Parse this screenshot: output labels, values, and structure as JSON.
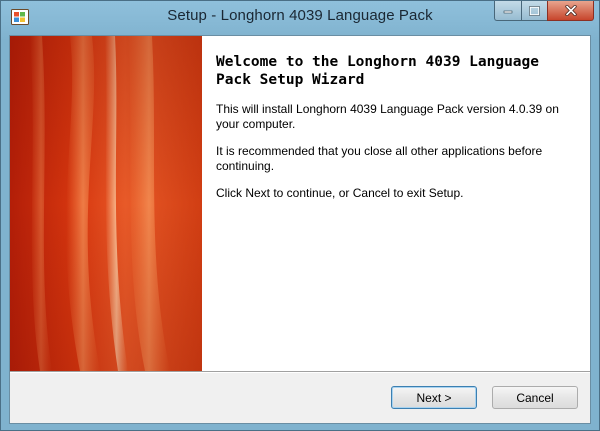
{
  "window": {
    "title": "Setup - Longhorn 4039 Language Pack",
    "icon": "setup-app-icon",
    "controls": {
      "minimize": "minimize-icon",
      "maximize": "maximize-icon",
      "close": "close-icon"
    }
  },
  "wizard": {
    "heading": "Welcome to the Longhorn 4039 Language Pack Setup Wizard",
    "paragraphs": [
      "This will install Longhorn 4039 Language Pack version 4.0.39 on your computer.",
      "It is recommended that you close all other applications before continuing.",
      "Click Next to continue, or Cancel to exit Setup."
    ]
  },
  "buttons": {
    "next": "Next >",
    "cancel": "Cancel"
  },
  "colors": {
    "banner_dark": "#b31e08",
    "banner_light": "#e85a28",
    "titlebar": "#7fb2ce",
    "close_button": "#c7452c"
  }
}
